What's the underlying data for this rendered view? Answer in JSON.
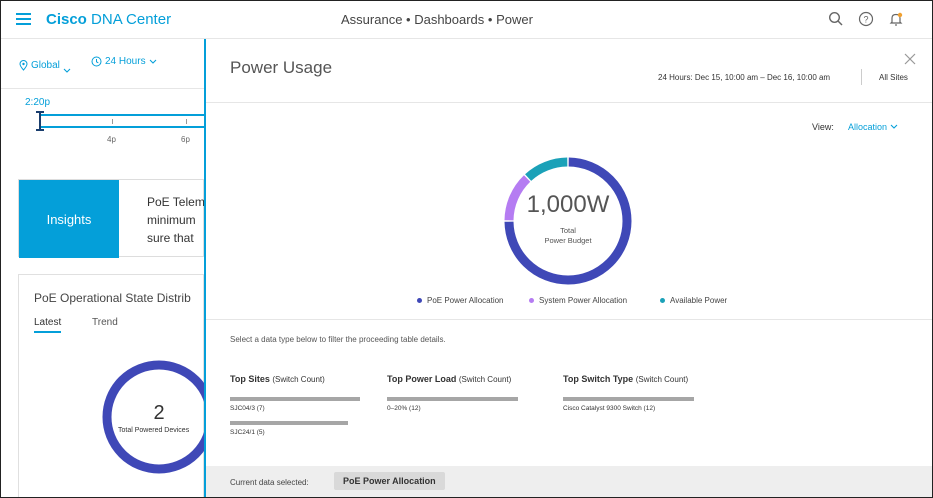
{
  "app": {
    "brand_bold": "Cisco",
    "brand_rest": " DNA Center",
    "breadcrumb": "Assurance • Dashboards • Power"
  },
  "top_icons": [
    "search-icon",
    "help-icon",
    "notification-bell-icon"
  ],
  "filters": {
    "location": "Global",
    "time_range": "24 Hours"
  },
  "timeline": {
    "current_time": "2:20p",
    "ticks": [
      "4p",
      "6p"
    ]
  },
  "insights": {
    "button_label": "Insights",
    "text_lines": [
      "PoE Telem",
      "minimum",
      "sure that"
    ]
  },
  "poe_card": {
    "title": "PoE Operational State Distrib",
    "tabs": [
      "Latest",
      "Trend"
    ],
    "total_value": "2",
    "total_label": "Total Powered Devices"
  },
  "drawer": {
    "title": "Power Usage",
    "time_range": "24 Hours: Dec 15, 10:00 am – Dec 16, 10:00 am",
    "sites": "All Sites",
    "view_label": "View:",
    "view_value": "Allocation",
    "donut": {
      "value": "1,000W",
      "label_line1": "Total",
      "label_line2": "Power Budget",
      "segments": [
        {
          "name": "PoE Power Allocation",
          "fraction": 0.75,
          "color": "#3f48b7"
        },
        {
          "name": "System Power Allocation",
          "fraction": 0.13,
          "color": "#b57cf2"
        },
        {
          "name": "Available Power",
          "fraction": 0.12,
          "color": "#1ba1b8"
        }
      ]
    },
    "legend": [
      "PoE Power Allocation",
      "System Power Allocation",
      "Available Power"
    ],
    "instructions": "Select a data type below to filter the proceeding table details.",
    "columns": [
      {
        "title": "Top Sites",
        "count_label": "(Switch Count)",
        "items": [
          {
            "label": "SJC04/3  (7)",
            "fraction": 1.0
          },
          {
            "label": "SJC24/1  (5)",
            "fraction": 0.92
          }
        ]
      },
      {
        "title": "Top Power Load",
        "count_label": "(Switch Count)",
        "items": [
          {
            "label": "0–20%  (12)",
            "fraction": 1.0
          }
        ]
      },
      {
        "title": "Top Switch Type",
        "count_label": "(Switch Count)",
        "items": [
          {
            "label": "Cisco Catalyst 9300 Switch  (12)",
            "fraction": 1.0
          }
        ]
      }
    ],
    "footer": {
      "label": "Current data selected:",
      "selected": "PoE Power Allocation"
    }
  }
}
